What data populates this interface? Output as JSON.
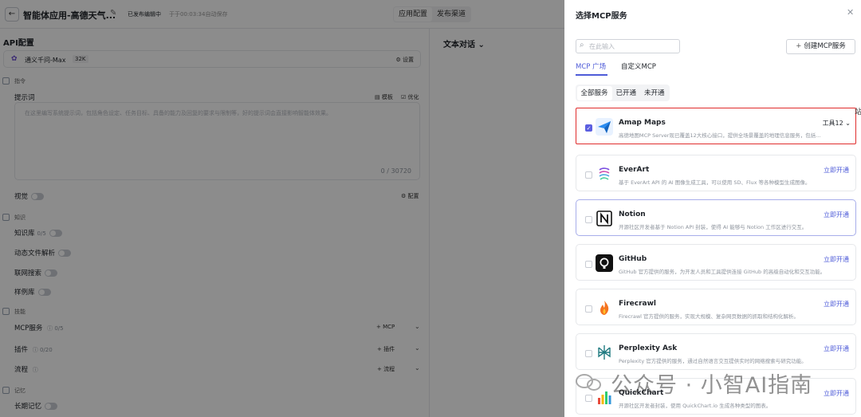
{
  "app": {
    "title": "智能体应用-高德天气...",
    "status": "已发布编辑中",
    "autosave": "于于00:03:34自动保存",
    "tabs": [
      "应用配置",
      "发布渠道"
    ],
    "section_title": "API配置",
    "model": {
      "name": "通义千问-Max",
      "badge": "32K",
      "settings_label": "设置"
    },
    "groups": {
      "instruction": "指令",
      "knowledge": "知识",
      "skills": "技能",
      "memory": "记忆"
    },
    "prompt": {
      "label": "提示词",
      "template_label": "模板",
      "optimize_label": "优化",
      "placeholder": "在这里编写系统提示词，包括角色设定、任务目标、具备的能力及回复的要求与限制等，好的提示词会直接影响智能体效果。",
      "counter": "0 / 30720"
    },
    "vision": {
      "label": "视觉",
      "config_label": "配置"
    },
    "knowledge_base": {
      "label": "知识库",
      "count": "0/5"
    },
    "doc_parse": {
      "label": "动态文件解析"
    },
    "web_search": {
      "label": "联网搜索"
    },
    "example_lib": {
      "label": "样例库"
    },
    "mcp": {
      "label": "MCP服务",
      "count": "0/5",
      "add_label": "MCP"
    },
    "plugins": {
      "label": "插件",
      "count": "0/20",
      "add_label": "插件"
    },
    "flows": {
      "label": "流程",
      "add_label": "流程"
    },
    "long_memory": {
      "label": "长期记忆"
    },
    "chat_title": "文本对话"
  },
  "drawer": {
    "title": "选择MCP服务",
    "search_placeholder": "在此输入",
    "create_button": "创建MCP服务",
    "tabs": [
      "MCP 广场",
      "自定义MCP"
    ],
    "filters": [
      "全部服务",
      "已开通",
      "未开通"
    ],
    "services": [
      {
        "name": "Amap Maps",
        "desc": "高德地图MCP Server现已覆盖12大核心接口，提供全场景覆盖的地理信息服务，包括地理编码、逆地理编码、IP定位、天气查询...",
        "action": "工具12",
        "icon": "amap-icon",
        "selected": true
      },
      {
        "name": "EverArt",
        "desc": "基于 EverArt API 的 AI 图像生成工具，可以使用 SD、Flux 等各种模型生成图像。",
        "action": "立即开通",
        "icon": "everart-icon"
      },
      {
        "name": "Notion",
        "desc": "开源社区开发者基于 Notion API 封装，使得 AI 能够与 Notion 工作区进行交互。",
        "action": "立即开通",
        "icon": "notion-icon"
      },
      {
        "name": "GitHub",
        "desc": "GitHub 官方提供的服务，为开发人员和工具提供连接 GitHub 的高级自动化和交互功能。",
        "action": "立即开通",
        "icon": "github-icon"
      },
      {
        "name": "Firecrawl",
        "desc": "Firecrawl 官方提供的服务，实现大规模、复杂网页数据的抓取和结构化解析。",
        "action": "立即开通",
        "icon": "firecrawl-icon"
      },
      {
        "name": "Perplexity Ask",
        "desc": "Perplexity 官方提供的服务，通过自然语言交互提供实时的网络搜索与研究功能。",
        "action": "立即开通",
        "icon": "perplexity-icon"
      },
      {
        "name": "QuickChart",
        "desc": "开源社区开发者封装，使用 QuickChart.io 生成各种类型的图表。",
        "action": "立即开通",
        "icon": "quickchart-icon"
      }
    ],
    "side_glyph": "站"
  },
  "watermark": "公众号 · 小智AI指南",
  "colors": {
    "accent": "#4e5bd8",
    "selected_border": "#e02d2d",
    "overlay": "rgba(0,0,0,0.45)"
  }
}
